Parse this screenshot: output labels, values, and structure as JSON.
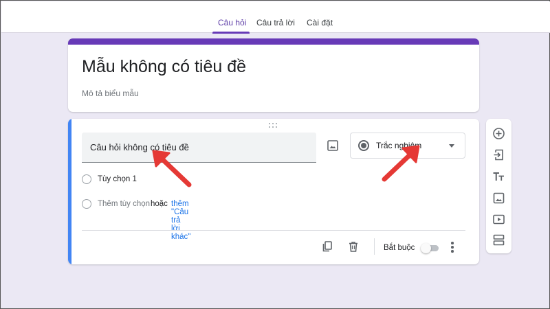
{
  "tabs": [
    {
      "label": "Câu hỏi",
      "active": true
    },
    {
      "label": "Câu trả lời",
      "active": false
    },
    {
      "label": "Cài đặt",
      "active": false
    }
  ],
  "form": {
    "title": "Mẫu không có tiêu đề",
    "description_placeholder": "Mô tả biểu mẫu"
  },
  "question": {
    "title": "Câu hỏi không có tiêu đề",
    "type": "Trắc nghiệm",
    "options": [
      {
        "label": "Tùy chọn 1"
      }
    ],
    "add_option": "Thêm tùy chọn",
    "or_text": "hoặc",
    "add_other": "thêm \"Câu trả lời khác\"",
    "required_label": "Bắt buộc",
    "required": false
  },
  "toolbar": {
    "icons": [
      "add-question-icon",
      "import-questions-icon",
      "add-title-icon",
      "add-image-icon",
      "add-video-icon",
      "add-section-icon"
    ]
  },
  "colors": {
    "accent": "#673ab7",
    "focus_bar": "#4285f4",
    "annotation_arrow": "#e53935",
    "background": "#ebe8f4"
  }
}
